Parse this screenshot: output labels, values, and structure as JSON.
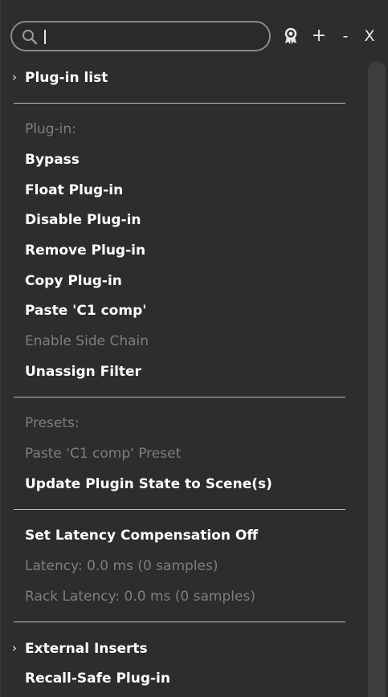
{
  "toolbar": {
    "search_value": "",
    "search_icon": "magnifier",
    "award_icon": "award-ribbon",
    "plus_label": "+",
    "minus_label": "-",
    "close_label": "X"
  },
  "menu": {
    "plugin_list": "Plug-in list",
    "plugin_header": "Plug-in:",
    "bypass": "Bypass",
    "float_plugin": "Float Plug-in",
    "disable_plugin": "Disable Plug-in",
    "remove_plugin": "Remove Plug-in",
    "copy_plugin": "Copy Plug-in",
    "paste_plugin": "Paste 'C1 comp'",
    "enable_side_chain": "Enable Side Chain",
    "unassign_filter": "Unassign Filter",
    "presets_header": "Presets:",
    "paste_preset": "Paste 'C1 comp' Preset",
    "update_plugin_state": "Update Plugin State to Scene(s)",
    "set_latency_off": "Set Latency Compensation Off",
    "latency": "Latency: 0.0 ms (0 samples)",
    "rack_latency": "Rack Latency: 0.0 ms (0 samples)",
    "external_inserts": "External Inserts",
    "recall_safe": "Recall-Safe Plug-in"
  }
}
